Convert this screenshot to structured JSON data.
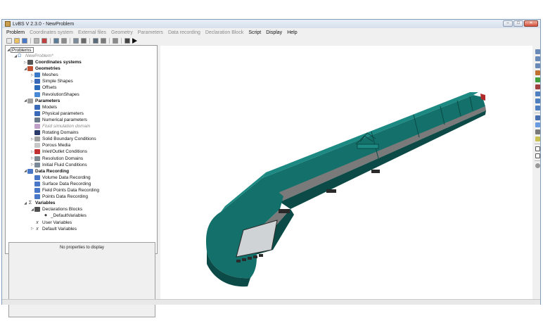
{
  "window": {
    "title": "LvBS V 2.3.0 - NewProblem",
    "controls": [
      "–",
      "□",
      "✕"
    ]
  },
  "menu": [
    {
      "label": "Problem",
      "enabled": true
    },
    {
      "label": "Coordinates system",
      "enabled": false
    },
    {
      "label": "External files",
      "enabled": false
    },
    {
      "label": "Geometry",
      "enabled": false
    },
    {
      "label": "Parameters",
      "enabled": false
    },
    {
      "label": "Data recording",
      "enabled": false
    },
    {
      "label": "Declaration Block",
      "enabled": false
    },
    {
      "label": "Script",
      "enabled": true
    },
    {
      "label": "Display",
      "enabled": true
    },
    {
      "label": "Help",
      "enabled": true
    }
  ],
  "toolbar_icons": [
    "new-file-icon",
    "open-folder-icon",
    "save-icon",
    "sep",
    "copy-icon",
    "delete-icon",
    "sep",
    "tree-icon",
    "gear-icon",
    "sep",
    "mesh-icon",
    "grid-icon",
    "sep",
    "export-icon",
    "table-icon",
    "sep",
    "print-icon",
    "sep",
    "script-icon",
    "run-icon"
  ],
  "tree": {
    "root": "Problems",
    "problem": "NewProblem*",
    "items": [
      {
        "label": "Coordinates systems",
        "level": 1,
        "bold": true,
        "icon": "axes-icon",
        "arrow": "▷",
        "color": "#555555"
      },
      {
        "label": "Geometries",
        "level": 1,
        "bold": true,
        "icon": "geometry-icon",
        "arrow": "◢",
        "color": "#c05030"
      },
      {
        "label": "Meshes",
        "level": 2,
        "icon": "mesh-icon",
        "arrow": "▷",
        "color": "#3a78c8"
      },
      {
        "label": "Simple Shapes",
        "level": 2,
        "icon": "shapes-icon",
        "arrow": "▷",
        "color": "#3a68b8"
      },
      {
        "label": "Offsets",
        "level": 2,
        "icon": "offsets-icon",
        "arrow": "",
        "color": "#2a6ab8"
      },
      {
        "label": "RevolutionShapes",
        "level": 2,
        "icon": "revolution-icon",
        "arrow": "",
        "color": "#4a88d8"
      },
      {
        "label": "Parameters",
        "level": 1,
        "bold": true,
        "icon": "parameters-icon",
        "arrow": "◢",
        "color": "#a0a0a0"
      },
      {
        "label": "Models",
        "level": 2,
        "icon": "models-icon",
        "arrow": "",
        "color": "#3a6ab8"
      },
      {
        "label": "Physical parameters",
        "level": 2,
        "icon": "physical-icon",
        "arrow": "",
        "color": "#3a6ab8"
      },
      {
        "label": "Numerical parameters",
        "level": 2,
        "icon": "numerical-icon",
        "arrow": "",
        "color": "#6a7a8a"
      },
      {
        "label": "Fluid simulation domain",
        "level": 2,
        "italic": true,
        "icon": "fluid-icon",
        "arrow": "",
        "color": "#c0a0c8"
      },
      {
        "label": "Rotating Domains",
        "level": 2,
        "icon": "rotating-icon",
        "arrow": "",
        "color": "#2a3a6a"
      },
      {
        "label": "Solid Boundary Conditions",
        "level": 2,
        "icon": "boundary-icon",
        "arrow": "▷",
        "color": "#a0a0a0"
      },
      {
        "label": "Porous Media",
        "level": 2,
        "icon": "porous-icon",
        "arrow": "",
        "color": "#c8c8c8"
      },
      {
        "label": "Inlet/Outlet Conditions",
        "level": 2,
        "icon": "inlet-icon",
        "arrow": "▷",
        "color": "#c03030"
      },
      {
        "label": "Resolution Domains",
        "level": 2,
        "icon": "resolution-icon",
        "arrow": "▷",
        "color": "#808890"
      },
      {
        "label": "Initial Fluid Conditions",
        "level": 2,
        "icon": "initial-icon",
        "arrow": "▷",
        "color": "#7a8a98"
      },
      {
        "label": "Data Recording",
        "level": 1,
        "bold": true,
        "icon": "recording-icon",
        "arrow": "◢",
        "color": "#4a78c8"
      },
      {
        "label": "Volume Data Recording",
        "level": 2,
        "icon": "volume-icon",
        "arrow": "",
        "color": "#4a78c8"
      },
      {
        "label": "Surface Data Recording",
        "level": 2,
        "icon": "surface-icon",
        "arrow": "",
        "color": "#4a78c8"
      },
      {
        "label": "Field Points Data Recording",
        "level": 2,
        "icon": "fieldpoints-icon",
        "arrow": "",
        "color": "#4a78c8"
      },
      {
        "label": "Points Data Recording",
        "level": 2,
        "icon": "points-icon",
        "arrow": "",
        "color": "#4a78c8"
      },
      {
        "label": "Variables",
        "level": 1,
        "bold": true,
        "icon": "sigma-icon",
        "arrow": "◢",
        "color": "#444444"
      },
      {
        "label": "Declarations Blocks",
        "level": 2,
        "icon": "declarations-icon",
        "arrow": "◢",
        "color": "#505050"
      },
      {
        "label": "_DefaultVariables",
        "level": 3,
        "icon": "bullet-icon",
        "arrow": "",
        "color": "#333333"
      },
      {
        "label": "User Variables",
        "level": 2,
        "icon": "x-icon",
        "arrow": "",
        "color": "#444444"
      },
      {
        "label": "Default Variables",
        "level": 2,
        "icon": "x-icon",
        "arrow": "▷",
        "color": "#444444"
      }
    ]
  },
  "properties": {
    "empty_text": "No properties to display"
  },
  "right_toolbar_icons": [
    "zoom-in-icon",
    "zoom-out-icon",
    "zoom-fit-icon",
    "axis-x-icon",
    "axis-y-icon",
    "axis-z-icon",
    "view-xy-icon",
    "view-xz-icon",
    "view-yz-icon",
    "sep",
    "iso-view-icon",
    "rotate-icon",
    "pan-icon",
    "light-icon",
    "sep",
    "shaded-icon",
    "wireframe-icon",
    "sep",
    "eye-icon"
  ],
  "colors": {
    "train_body": "#14706a",
    "train_dark": "#0b4a46",
    "train_stripe": "#7a7a7a",
    "window_glass": "#cfd3d6",
    "accent_red": "#b02828"
  }
}
